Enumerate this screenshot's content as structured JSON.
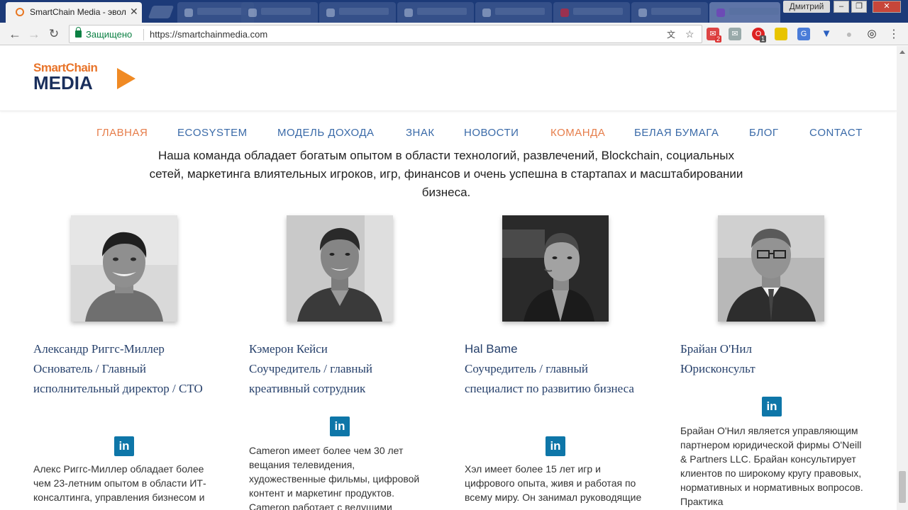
{
  "browser": {
    "active_tab_title": "SmartChain Media - эвол",
    "user_name": "Дмитрий",
    "secure_label": "Защищено",
    "url": "https://smartchainmedia.com",
    "extension_badges": [
      "2",
      "1"
    ]
  },
  "nav": {
    "items": [
      {
        "label": "ГЛАВНАЯ",
        "active": true
      },
      {
        "label": "ECOSYSTEM",
        "active": false
      },
      {
        "label": "МОДЕЛЬ ДОХОДА",
        "active": false
      },
      {
        "label": "ЗНАК",
        "active": false
      },
      {
        "label": "НОВОСТИ",
        "active": false
      },
      {
        "label": "КОМАНДА",
        "active": true
      },
      {
        "label": "БЕЛАЯ БУМАГА",
        "active": false
      },
      {
        "label": "БЛОГ",
        "active": false
      },
      {
        "label": "CONTACT",
        "active": false
      }
    ]
  },
  "intro_text": "Наша команда обладает богатым опытом в области технологий, развлечений, Blockchain, социальных сетей, маркетинга влиятельных игроков, игр, финансов и очень успешна в стартапах и масштабировании бизнеса.",
  "team": [
    {
      "name": "Александр Риггс-Миллер",
      "role": "Основатель / Главный исполнительный директор / СТО",
      "bio": "Алекс Риггс-Миллер обладает более чем 23-летним опытом в области ИТ-консалтинга, управления бизнесом и"
    },
    {
      "name": "Кэмерон Кейси",
      "role": "Соучредитель / главный креативный сотрудник",
      "bio": "Cameron имеет более чем 30 лет вещания телевидения, художественные фильмы, цифровой контент и маркетинг продуктов. Cameron работает с ведущими"
    },
    {
      "name": "Hal Bame",
      "role": "Соучредитель / главный специалист по развитию бизнеса",
      "bio": "Хэл имеет более 15 лет игр и цифрового опыта, живя и работая по всему миру. Он занимал руководящие"
    },
    {
      "name": "Брайан О'Нил",
      "role": "Юрисконсульт",
      "bio": "Брайан О'Нил является управляющим партнером юридической фирмы O'Neill & Partners LLC. Брайан консультирует клиентов по широкому кругу правовых, нормативных и нормативных вопросов. Практика"
    }
  ],
  "logo": {
    "line1": "SmartChain",
    "line2": "MEDIA"
  },
  "linkedin_label": "in",
  "colors": {
    "nav_link": "#3a6aa8",
    "nav_active": "#e67d4a",
    "heading": "#26406b",
    "linkedin": "#0e76a8",
    "logo_orange": "#f08a24",
    "logo_navy": "#1a2f5c"
  }
}
